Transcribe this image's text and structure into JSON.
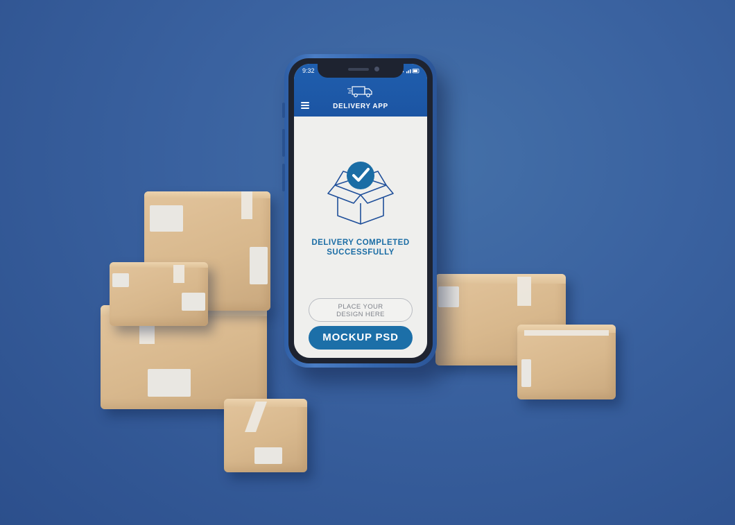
{
  "app": {
    "status_time": "9:32",
    "title": "DELIVERY APP",
    "success_line1": "DELIVERY COMPLETED",
    "success_line2": "SUCCESSFULLY",
    "placeholder_line1": "PLACE YOUR",
    "placeholder_line2": "DESIGN HERE",
    "button_label": "MOCKUP PSD"
  },
  "icons": {
    "menu": "hamburger-icon",
    "truck": "delivery-truck-icon",
    "box_check": "box-checkmark-icon",
    "status": "signal-wifi-battery-icon"
  },
  "colors": {
    "background": "#3a62a0",
    "header": "#1f5eae",
    "accent": "#1c6fa8",
    "cardboard": "#d8b88d"
  }
}
